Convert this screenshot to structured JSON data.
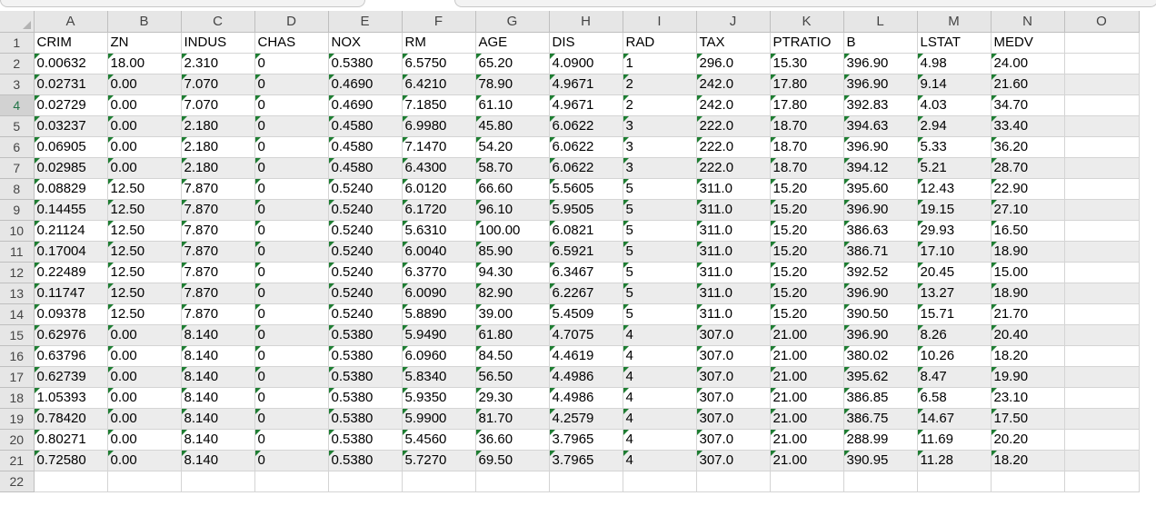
{
  "corner": {
    "icon": "select-all-icon"
  },
  "column_letters": [
    "A",
    "B",
    "C",
    "D",
    "E",
    "F",
    "G",
    "H",
    "I",
    "J",
    "K",
    "L",
    "M",
    "N",
    "O"
  ],
  "row_numbers": [
    "1",
    "2",
    "3",
    "4",
    "5",
    "6",
    "7",
    "8",
    "9",
    "10",
    "11",
    "12",
    "13",
    "14",
    "15",
    "16",
    "17",
    "18",
    "19",
    "20",
    "21",
    "22"
  ],
  "active_row": "4",
  "headers": [
    "CRIM",
    "ZN",
    "INDUS",
    "CHAS",
    "NOX",
    "RM",
    "AGE",
    "DIS",
    "RAD",
    "TAX",
    "PTRATIO",
    "B",
    "LSTAT",
    "MEDV"
  ],
  "rows": [
    [
      "0.00632",
      "18.00",
      "2.310",
      "0",
      "0.5380",
      "6.5750",
      "65.20",
      "4.0900",
      "1",
      "296.0",
      "15.30",
      "396.90",
      "4.98",
      "24.00"
    ],
    [
      "0.02731",
      "0.00",
      "7.070",
      "0",
      "0.4690",
      "6.4210",
      "78.90",
      "4.9671",
      "2",
      "242.0",
      "17.80",
      "396.90",
      "9.14",
      "21.60"
    ],
    [
      "0.02729",
      "0.00",
      "7.070",
      "0",
      "0.4690",
      "7.1850",
      "61.10",
      "4.9671",
      "2",
      "242.0",
      "17.80",
      "392.83",
      "4.03",
      "34.70"
    ],
    [
      "0.03237",
      "0.00",
      "2.180",
      "0",
      "0.4580",
      "6.9980",
      "45.80",
      "6.0622",
      "3",
      "222.0",
      "18.70",
      "394.63",
      "2.94",
      "33.40"
    ],
    [
      "0.06905",
      "0.00",
      "2.180",
      "0",
      "0.4580",
      "7.1470",
      "54.20",
      "6.0622",
      "3",
      "222.0",
      "18.70",
      "396.90",
      "5.33",
      "36.20"
    ],
    [
      "0.02985",
      "0.00",
      "2.180",
      "0",
      "0.4580",
      "6.4300",
      "58.70",
      "6.0622",
      "3",
      "222.0",
      "18.70",
      "394.12",
      "5.21",
      "28.70"
    ],
    [
      "0.08829",
      "12.50",
      "7.870",
      "0",
      "0.5240",
      "6.0120",
      "66.60",
      "5.5605",
      "5",
      "311.0",
      "15.20",
      "395.60",
      "12.43",
      "22.90"
    ],
    [
      "0.14455",
      "12.50",
      "7.870",
      "0",
      "0.5240",
      "6.1720",
      "96.10",
      "5.9505",
      "5",
      "311.0",
      "15.20",
      "396.90",
      "19.15",
      "27.10"
    ],
    [
      "0.21124",
      "12.50",
      "7.870",
      "0",
      "0.5240",
      "5.6310",
      "100.00",
      "6.0821",
      "5",
      "311.0",
      "15.20",
      "386.63",
      "29.93",
      "16.50"
    ],
    [
      "0.17004",
      "12.50",
      "7.870",
      "0",
      "0.5240",
      "6.0040",
      "85.90",
      "6.5921",
      "5",
      "311.0",
      "15.20",
      "386.71",
      "17.10",
      "18.90"
    ],
    [
      "0.22489",
      "12.50",
      "7.870",
      "0",
      "0.5240",
      "6.3770",
      "94.30",
      "6.3467",
      "5",
      "311.0",
      "15.20",
      "392.52",
      "20.45",
      "15.00"
    ],
    [
      "0.11747",
      "12.50",
      "7.870",
      "0",
      "0.5240",
      "6.0090",
      "82.90",
      "6.2267",
      "5",
      "311.0",
      "15.20",
      "396.90",
      "13.27",
      "18.90"
    ],
    [
      "0.09378",
      "12.50",
      "7.870",
      "0",
      "0.5240",
      "5.8890",
      "39.00",
      "5.4509",
      "5",
      "311.0",
      "15.20",
      "390.50",
      "15.71",
      "21.70"
    ],
    [
      "0.62976",
      "0.00",
      "8.140",
      "0",
      "0.5380",
      "5.9490",
      "61.80",
      "4.7075",
      "4",
      "307.0",
      "21.00",
      "396.90",
      "8.26",
      "20.40"
    ],
    [
      "0.63796",
      "0.00",
      "8.140",
      "0",
      "0.5380",
      "6.0960",
      "84.50",
      "4.4619",
      "4",
      "307.0",
      "21.00",
      "380.02",
      "10.26",
      "18.20"
    ],
    [
      "0.62739",
      "0.00",
      "8.140",
      "0",
      "0.5380",
      "5.8340",
      "56.50",
      "4.4986",
      "4",
      "307.0",
      "21.00",
      "395.62",
      "8.47",
      "19.90"
    ],
    [
      "1.05393",
      "0.00",
      "8.140",
      "0",
      "0.5380",
      "5.9350",
      "29.30",
      "4.4986",
      "4",
      "307.0",
      "21.00",
      "386.85",
      "6.58",
      "23.10"
    ],
    [
      "0.78420",
      "0.00",
      "8.140",
      "0",
      "0.5380",
      "5.9900",
      "81.70",
      "4.2579",
      "4",
      "307.0",
      "21.00",
      "386.75",
      "14.67",
      "17.50"
    ],
    [
      "0.80271",
      "0.00",
      "8.140",
      "0",
      "0.5380",
      "5.4560",
      "36.60",
      "3.7965",
      "4",
      "307.0",
      "21.00",
      "288.99",
      "11.69",
      "20.20"
    ],
    [
      "0.72580",
      "0.00",
      "8.140",
      "0",
      "0.5380",
      "5.7270",
      "69.50",
      "3.7965",
      "4",
      "307.0",
      "21.00",
      "390.95",
      "11.28",
      "18.20"
    ]
  ]
}
